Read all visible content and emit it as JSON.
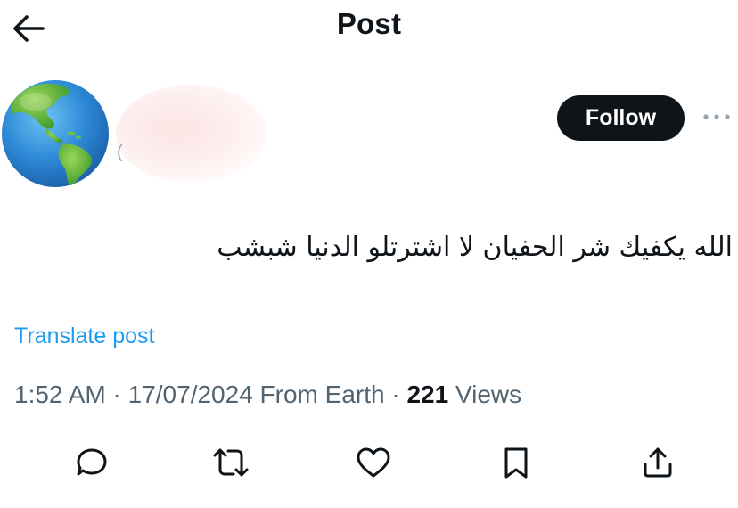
{
  "header": {
    "title": "Post",
    "back_icon": "arrow-left-icon"
  },
  "author": {
    "avatar_icon": "globe-icon",
    "follow_label": "Follow",
    "more_icon": "more-horizontal-icon"
  },
  "post": {
    "text": "الله يكفيك شر الحفيان لا اشترتلو الدنيا شبشب",
    "translate_label": "Translate post",
    "time": "1:52 AM",
    "date": "17/07/2024",
    "source": "From Earth",
    "views_count": "221",
    "views_label": "Views",
    "separator": "·"
  },
  "actions": [
    {
      "name": "reply",
      "icon": "reply-icon"
    },
    {
      "name": "repost",
      "icon": "repost-icon"
    },
    {
      "name": "like",
      "icon": "heart-icon"
    },
    {
      "name": "bookmark",
      "icon": "bookmark-icon"
    },
    {
      "name": "share",
      "icon": "share-icon"
    }
  ],
  "colors": {
    "text_primary": "#0f1419",
    "text_secondary": "#536471",
    "link": "#1d9bf0",
    "follow_bg": "#0f1419"
  }
}
